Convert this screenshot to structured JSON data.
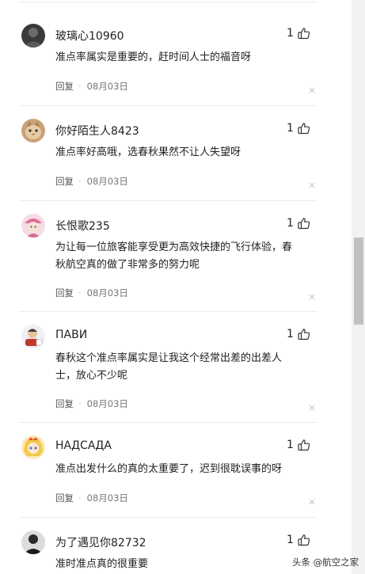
{
  "comments": [
    {
      "username": "玻璃心10960",
      "likes": "1",
      "lines": [
        "准点率属实是重要的，赶时间人士的福音呀"
      ],
      "reply": "回复",
      "date": "08月03日",
      "avatar": "dark-silhouette"
    },
    {
      "username": "你好陌生人8423",
      "likes": "1",
      "lines": [
        "准点率好高哦，选春秋果然不让人失望呀"
      ],
      "reply": "回复",
      "date": "08月03日",
      "avatar": "kitten"
    },
    {
      "username": "长恨歌235",
      "likes": "1",
      "lines": [
        "为让每一位旅客能享受更为高效快捷的飞行体验，春",
        "秋航空真的做了非常多的努力呢"
      ],
      "reply": "回复",
      "date": "08月03日",
      "avatar": "girl-pink-hat"
    },
    {
      "username": "ПАВИ",
      "likes": "1",
      "lines": [
        "春秋这个准点率属实是让我这个经常出差的出差人",
        "士，放心不少呢"
      ],
      "reply": "回复",
      "date": "08月03日",
      "avatar": "cartoon-character"
    },
    {
      "username": "НАДСАДА",
      "likes": "1",
      "lines": [
        "准点出发什么的真的太重要了，迟到很耽误事的呀"
      ],
      "reply": "回复",
      "date": "08月03日",
      "avatar": "anime-blonde"
    },
    {
      "username": "为了遇见你82732",
      "likes": "1",
      "lines": [
        "准时准点真的很重要"
      ],
      "reply": "",
      "date": "",
      "avatar": "dark-portrait"
    }
  ],
  "watermark": "头条 @航空之家",
  "icons": {
    "like": "thumbs-up-icon",
    "delete": "close-icon"
  }
}
